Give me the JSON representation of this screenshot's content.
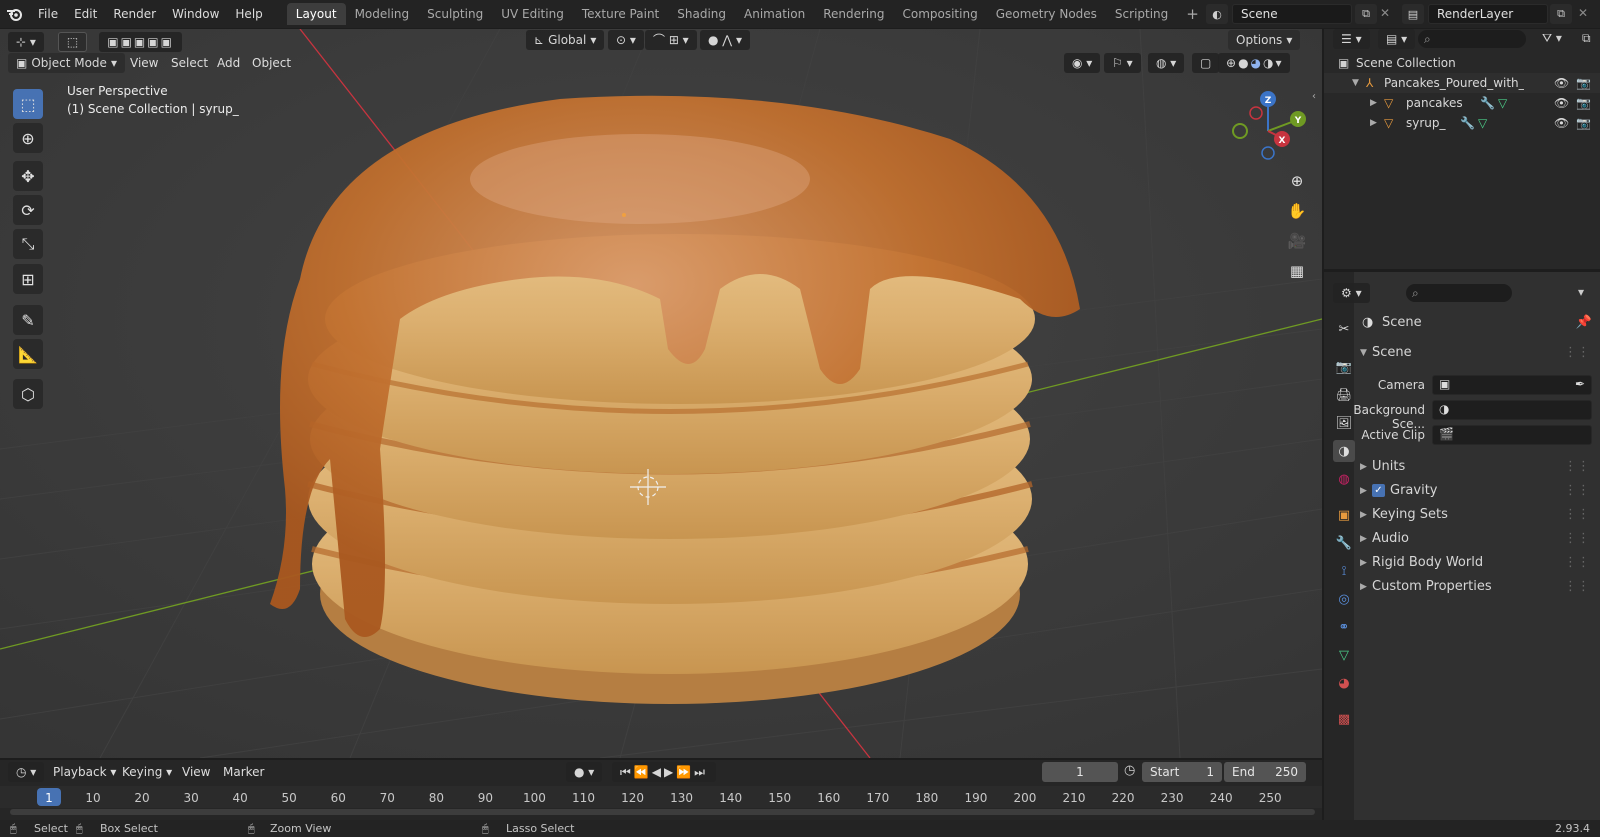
{
  "top_menu": [
    "File",
    "Edit",
    "Render",
    "Window",
    "Help"
  ],
  "workspaces": [
    "Layout",
    "Modeling",
    "Sculpting",
    "UV Editing",
    "Texture Paint",
    "Shading",
    "Animation",
    "Rendering",
    "Compositing",
    "Geometry Nodes",
    "Scripting"
  ],
  "active_workspace": "Layout",
  "scene_name": "Scene",
  "render_layer": "RenderLayer",
  "viewport": {
    "transform_orientation": "Global",
    "options_label": "Options",
    "mode": "Object Mode",
    "menus": [
      "View",
      "Select",
      "Add",
      "Object"
    ],
    "overlay_title": "User Perspective",
    "overlay_subtitle": "(1) Scene Collection | syrup_",
    "gizmo": {
      "z": "Z",
      "y": "Y",
      "x": "X"
    }
  },
  "outliner": {
    "root": "Scene Collection",
    "items": [
      {
        "name": "Pancakes_Poured_with_Syrup",
        "level": 0
      },
      {
        "name": "pancakes",
        "level": 1
      },
      {
        "name": "syrup_",
        "level": 1
      }
    ]
  },
  "properties": {
    "header": "Scene",
    "panel_title": "Scene",
    "fields": [
      {
        "label": "Camera"
      },
      {
        "label": "Background Sce..."
      },
      {
        "label": "Active Clip"
      }
    ],
    "sections": [
      "Units",
      "Gravity",
      "Keying Sets",
      "Audio",
      "Rigid Body World",
      "Custom Properties"
    ],
    "gravity_checked": true
  },
  "timeline": {
    "menus": [
      "Playback",
      "Keying",
      "View",
      "Marker"
    ],
    "current_frame": "1",
    "start_label": "Start",
    "start_value": "1",
    "end_label": "End",
    "end_value": "250",
    "ticks": [
      "1",
      "10",
      "20",
      "30",
      "40",
      "50",
      "60",
      "70",
      "80",
      "90",
      "100",
      "110",
      "120",
      "130",
      "140",
      "150",
      "160",
      "170",
      "180",
      "190",
      "200",
      "210",
      "220",
      "230",
      "240",
      "250"
    ]
  },
  "status_bar": {
    "select": "Select",
    "box_select": "Box Select",
    "zoom_view": "Zoom View",
    "lasso_select": "Lasso Select",
    "version": "2.93.4"
  },
  "colors": {
    "accent": "#4772b3",
    "axis_x": "#c7343f",
    "axis_y": "#6f9a23",
    "axis_z": "#3b74c7"
  }
}
